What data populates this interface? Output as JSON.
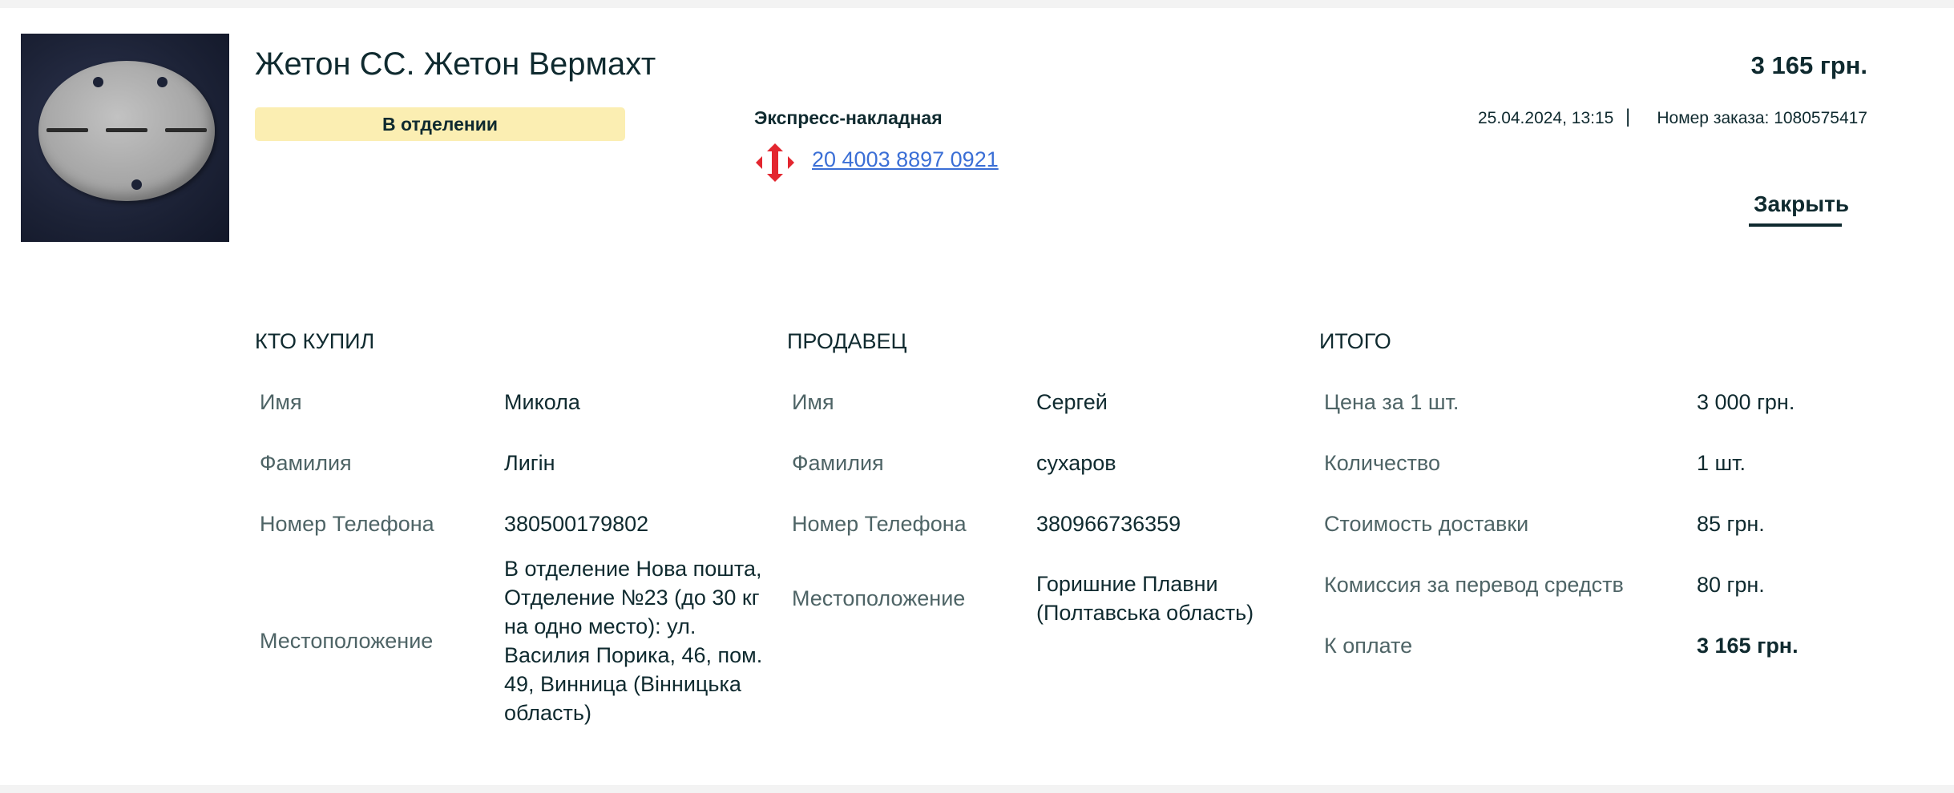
{
  "product": {
    "title": "Жетон СС. Жетон Вермахт",
    "price": "3 165 грн.",
    "status": "В отделении"
  },
  "shipping": {
    "waybill_label": "Экспресс-накладная",
    "waybill_number": "20 4003 8897 0921",
    "carrier_icon": "nova-poshta-icon"
  },
  "order": {
    "date": "25.04.2024, 13:15",
    "separator": "|",
    "number_text": "Номер заказа: 1080575417"
  },
  "close_label": "Закрыть",
  "buyer": {
    "title": "КТО КУПИЛ",
    "rows": [
      {
        "label": "Имя",
        "value": "Микола"
      },
      {
        "label": "Фамилия",
        "value": "Лигін"
      },
      {
        "label": "Номер Телефона",
        "value": "380500179802"
      },
      {
        "label": "Местоположение",
        "value": "В отделение Нова пошта, Отделение №23 (до 30 кг на одно место): ул. Василия Порика, 46, пом. 49, Винница (Вінницька область)"
      }
    ]
  },
  "seller": {
    "title": "ПРОДАВЕЦ",
    "rows": [
      {
        "label": "Имя",
        "value": "Сергей"
      },
      {
        "label": "Фамилия",
        "value": "сухаров"
      },
      {
        "label": "Номер Телефона",
        "value": "380966736359"
      },
      {
        "label": "Местоположение",
        "value": "Горишние Плавни (Полтавська область)"
      }
    ]
  },
  "total": {
    "title": "ИТОГО",
    "rows": [
      {
        "label": "Цена за 1 шт.",
        "value": "3 000 грн."
      },
      {
        "label": "Количество",
        "value": "1 шт."
      },
      {
        "label": "Стоимость доставки",
        "value": "85 грн."
      },
      {
        "label": "Комиссия за перевод средств",
        "value": "80 грн."
      },
      {
        "label": "К оплате",
        "value": "3 165 грн."
      }
    ]
  },
  "colors": {
    "text": "#0f2a2f",
    "muted": "#4e6466",
    "badge_bg": "#fbeeb2",
    "link": "#3b6fd6",
    "carrier_red": "#e3262f"
  }
}
